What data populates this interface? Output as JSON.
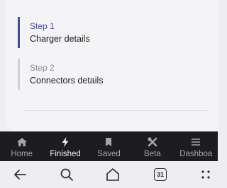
{
  "steps": [
    {
      "number": "Step 1",
      "title": "Charger details",
      "active": true
    },
    {
      "number": "Step 2",
      "title": "Connectors details",
      "active": false
    }
  ],
  "nav": {
    "items": [
      {
        "label": "Home",
        "icon": "home-icon"
      },
      {
        "label": "Finished",
        "icon": "bolt-icon"
      },
      {
        "label": "Saved",
        "icon": "bookmark-icon"
      },
      {
        "label": "Beta",
        "icon": "tools-icon"
      },
      {
        "label": "Dashboa",
        "icon": "menu-icon"
      }
    ],
    "active_index": 1
  },
  "system_bar": {
    "calendar_day": "31",
    "icons": [
      "back-arrow-icon",
      "search-icon",
      "home-outline-icon",
      "calendar-icon",
      "apps-icon"
    ]
  },
  "colors": {
    "accent": "#3e4f9e",
    "nav_background": "#1d1d21"
  }
}
